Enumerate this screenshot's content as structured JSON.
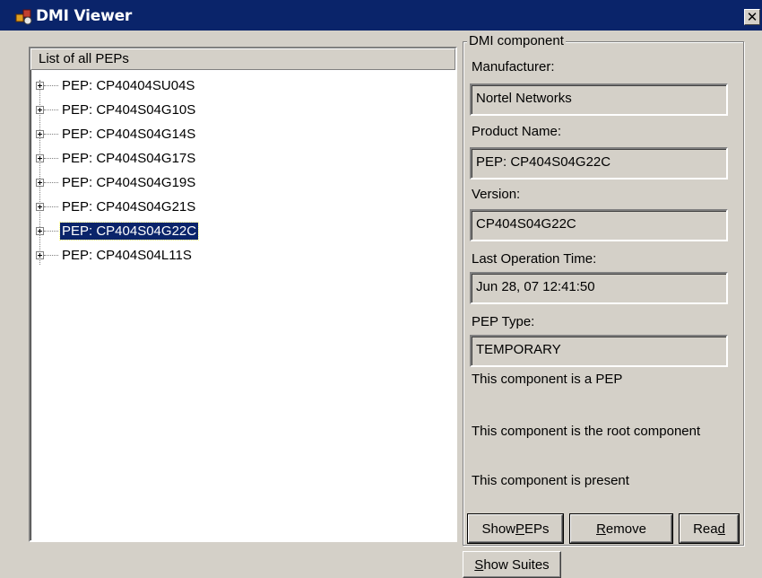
{
  "window": {
    "title": "DMI Viewer",
    "close_glyph": "✕"
  },
  "tree": {
    "header": "List of all PEPs",
    "items": [
      {
        "label": "PEP: CP40404SU04S",
        "selected": false
      },
      {
        "label": "PEP: CP404S04G10S",
        "selected": false
      },
      {
        "label": "PEP: CP404S04G14S",
        "selected": false
      },
      {
        "label": "PEP: CP404S04G17S",
        "selected": false
      },
      {
        "label": "PEP: CP404S04G19S",
        "selected": false
      },
      {
        "label": "PEP: CP404S04G21S",
        "selected": false
      },
      {
        "label": "PEP: CP404S04G22C",
        "selected": true
      },
      {
        "label": "PEP: CP404S04L11S",
        "selected": false
      }
    ]
  },
  "component": {
    "legend": "DMI component",
    "manufacturer_label": "Manufacturer:",
    "manufacturer_value": "Nortel Networks",
    "product_label": "Product Name:",
    "product_value": "PEP: CP404S04G22C",
    "version_label": "Version:",
    "version_value": "CP404S04G22C",
    "last_op_label": "Last Operation Time:",
    "last_op_value": "Jun 28, 07  12:41:50",
    "pep_type_label": "PEP Type:",
    "pep_type_value": "TEMPORARY",
    "status_pep": "This component is a PEP",
    "status_root": "This component is the root component",
    "status_present": "This component is present"
  },
  "buttons": {
    "show_peps": {
      "before": "Show ",
      "mnemonic": "P",
      "after": "EPs"
    },
    "remove": {
      "before": "",
      "mnemonic": "R",
      "after": "emove"
    },
    "read": {
      "before": "Rea",
      "mnemonic": "d",
      "after": ""
    },
    "show_suites": {
      "before": "",
      "mnemonic": "S",
      "after": "how Suites"
    }
  },
  "icons": {
    "app": "dmi-app-icon",
    "close": "close-icon",
    "expander": "tree-expand-plus-icon"
  }
}
